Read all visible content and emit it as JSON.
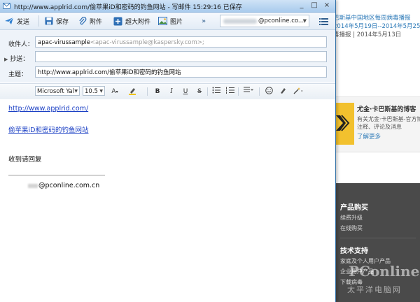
{
  "window": {
    "title": "http://www.applrid.com/偷苹果iD和密码的钓鱼网站 - 写邮件   15:29:16 已保存",
    "controls": [
      "_",
      "□",
      "×"
    ]
  },
  "toolbar": {
    "send": "发送",
    "save": "保存",
    "attach": "附件",
    "big_attach": "超大附件",
    "picture": "图片",
    "more": "»",
    "sender_suffix": "@pconline.co...",
    "menu_icon": "list-menu-icon"
  },
  "header": {
    "to_label": "收件人：",
    "to_name": "apac-virussample",
    "to_email": "<apac-virussample@kaspersky.com>;",
    "cc_label": "抄送：",
    "cc_value": "",
    "subject_label": "主题：",
    "subject_value": "http://www.applrid.com/偷苹果iD和密码的钓鱼网站"
  },
  "format": {
    "font": "Microsoft Yal",
    "size": "10.5",
    "buttons": [
      "A",
      "B",
      "I",
      "U",
      "S"
    ]
  },
  "body": {
    "line1": "http://www.applrid.com/",
    "line2": "偷苹果iD和密码的钓鱼网站",
    "line3": "收到请回复",
    "signature": "@pconline.com.cn"
  },
  "background": {
    "news": {
      "line1": "巴斯基中国地区每周病毒播报",
      "line2": "2014年5月19日--2014年5月25日)",
      "line3": "毒播报 | 2014年5月13日"
    },
    "blog": {
      "title": "尤金·卡巴斯基的博客",
      "desc1": "有关尤金·卡巴斯基-官方博",
      "desc2": "注释、评论及消息",
      "more": "了解更多"
    },
    "products": {
      "heading": "产品购买",
      "items": [
        "续费升级",
        "在线购买"
      ]
    },
    "support": {
      "heading": "技术支持",
      "items": [
        "家庭及个人用户产品",
        "企业用户产品",
        "下载病毒"
      ]
    },
    "watermark": {
      "logo": "PConline",
      "sub": "太平洋电脑网"
    }
  }
}
